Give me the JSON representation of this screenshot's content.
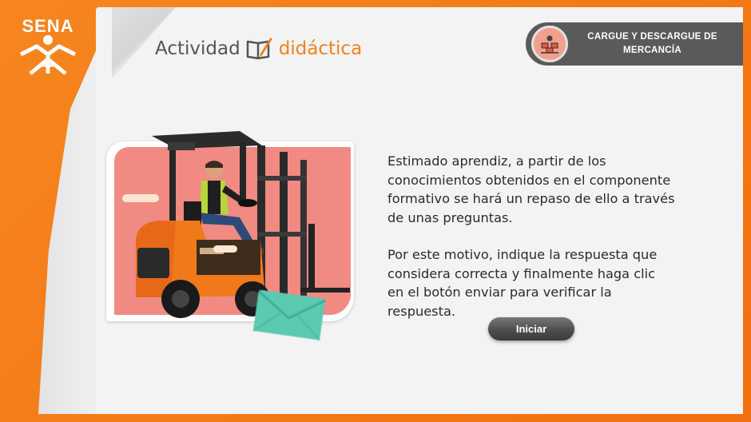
{
  "brand": {
    "logo_text": "SENA",
    "logo_icon": "sena-logo-icon"
  },
  "header": {
    "title_part1": "Actividad",
    "title_part2": "didáctica",
    "title_icon": "book-pencil-icon"
  },
  "topic_tag": {
    "line1": "CARGUE Y DESCARGUE DE",
    "line2": "MERCANCÍA",
    "icon": "warehouse-boxes-icon"
  },
  "illustration": {
    "icon": "forklift-operator-image",
    "decor_icon": "envelope-icon"
  },
  "message": {
    "paragraph1": "Estimado aprendiz, a partir de los conocimientos obtenidos en el componente formativo se hará un repaso de ello a través de unas preguntas.",
    "paragraph2": "Por este motivo, indique la respuesta que considera correcta y finalmente haga clic en el botón enviar para verificar la respuesta."
  },
  "start_button": {
    "label": "Iniciar"
  },
  "colors": {
    "brand_orange": "#f47a17",
    "tag_gray": "#5a5a5a",
    "photo_pink": "#f08a82",
    "forklift_orange": "#f07a1a"
  }
}
